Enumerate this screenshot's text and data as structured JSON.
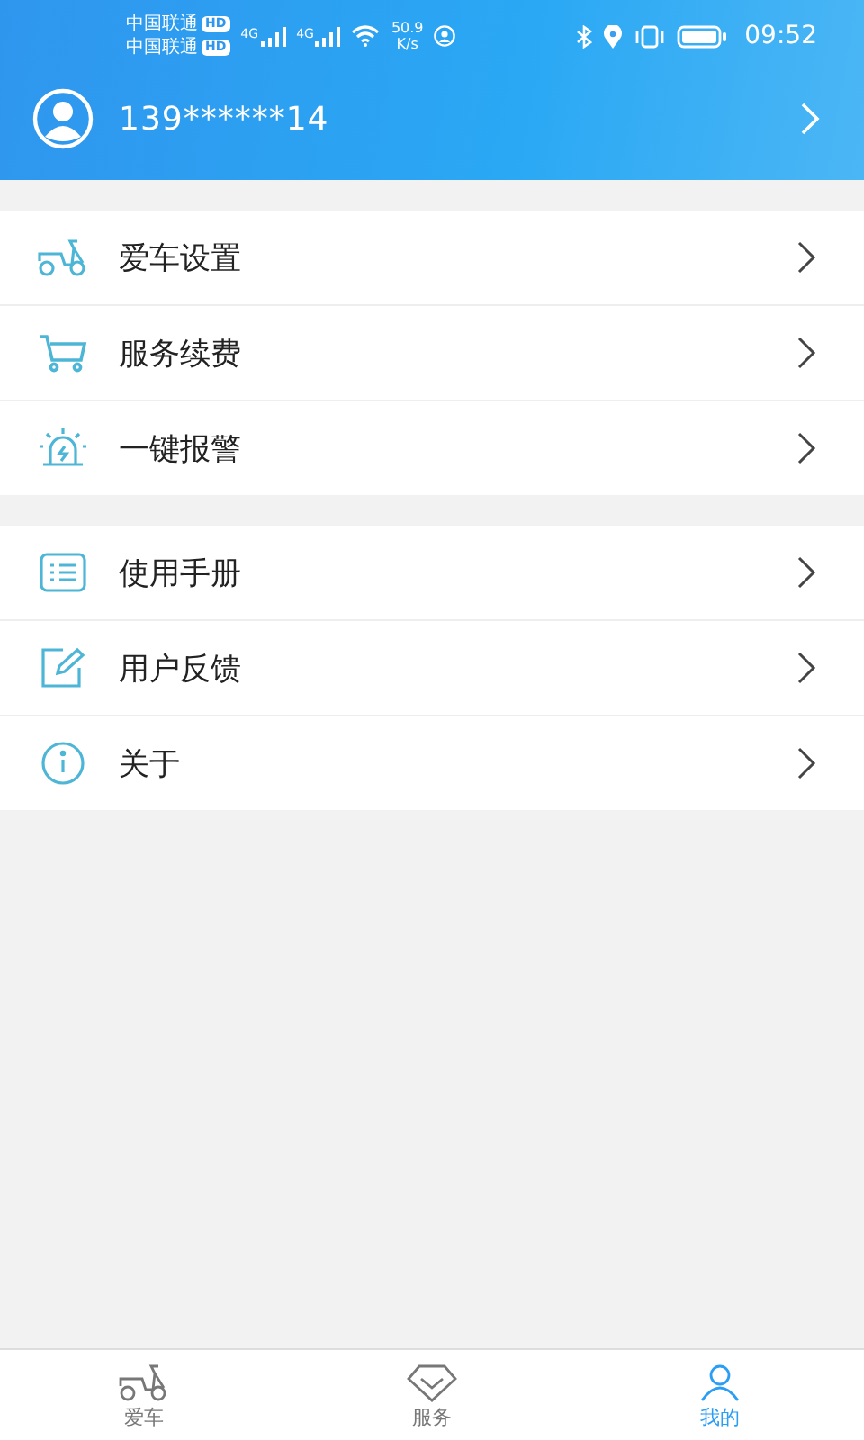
{
  "status_bar": {
    "carriers": [
      "中国联通",
      "中国联通"
    ],
    "carrier_badges": [
      "HD",
      "HD"
    ],
    "network_labels": [
      "4G",
      "4G"
    ],
    "speed": "50.9",
    "speed_unit": "K/s",
    "time": "09:52"
  },
  "profile": {
    "phone": "139******14"
  },
  "menu_groups": [
    {
      "items": [
        {
          "label": "爱车设置",
          "kind": "scooter"
        },
        {
          "label": "服务续费",
          "kind": "cart"
        },
        {
          "label": "一键报警",
          "kind": "alarm"
        }
      ]
    },
    {
      "items": [
        {
          "label": "使用手册",
          "kind": "list"
        },
        {
          "label": "用户反馈",
          "kind": "edit"
        },
        {
          "label": "关于",
          "kind": "info"
        }
      ]
    }
  ],
  "bottom_nav": [
    {
      "label": "爱车",
      "kind": "scooter",
      "selected": false
    },
    {
      "label": "服务",
      "kind": "diamond",
      "selected": false
    },
    {
      "label": "我的",
      "kind": "person",
      "selected": true
    }
  ]
}
